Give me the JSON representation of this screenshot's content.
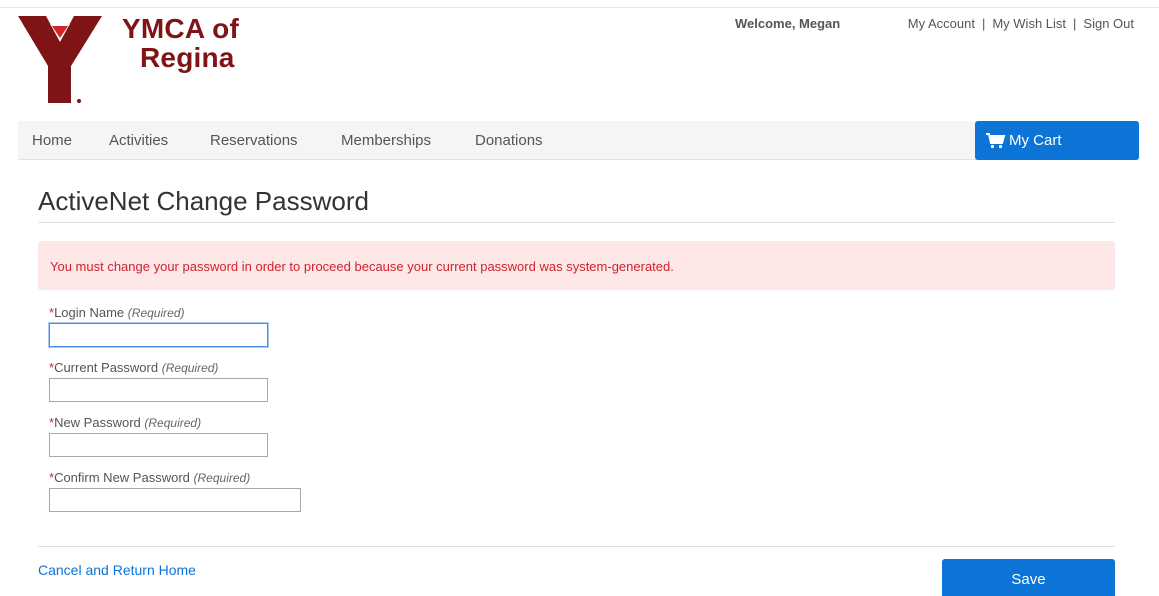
{
  "logo": {
    "line1": "YMCA of",
    "line2": "Regina",
    "brand_color": "#7e1416"
  },
  "header": {
    "welcome": "Welcome, Megan",
    "links": [
      "My Account",
      "My Wish List",
      "Sign Out"
    ],
    "separator": "|"
  },
  "nav": {
    "items": [
      "Home",
      "Activities",
      "Reservations",
      "Memberships",
      "Donations"
    ],
    "cart_label": "My Cart",
    "cart_icon": "shopping-cart-icon",
    "accent_color": "#0b74d6"
  },
  "page": {
    "title": "ActiveNet Change Password"
  },
  "alert": {
    "message": "You must change your password in order to proceed because your current password was system-generated.",
    "text_color": "#d0232e",
    "bg_color": "#fde7e7"
  },
  "form": {
    "required_mark": "*",
    "required_note": "(Required)",
    "fields": [
      {
        "label": "Login Name",
        "value": ""
      },
      {
        "label": "Current Password",
        "value": ""
      },
      {
        "label": "New Password",
        "value": ""
      },
      {
        "label": "Confirm New Password",
        "value": ""
      }
    ]
  },
  "actions": {
    "cancel_label": "Cancel and Return Home",
    "save_label": "Save"
  }
}
